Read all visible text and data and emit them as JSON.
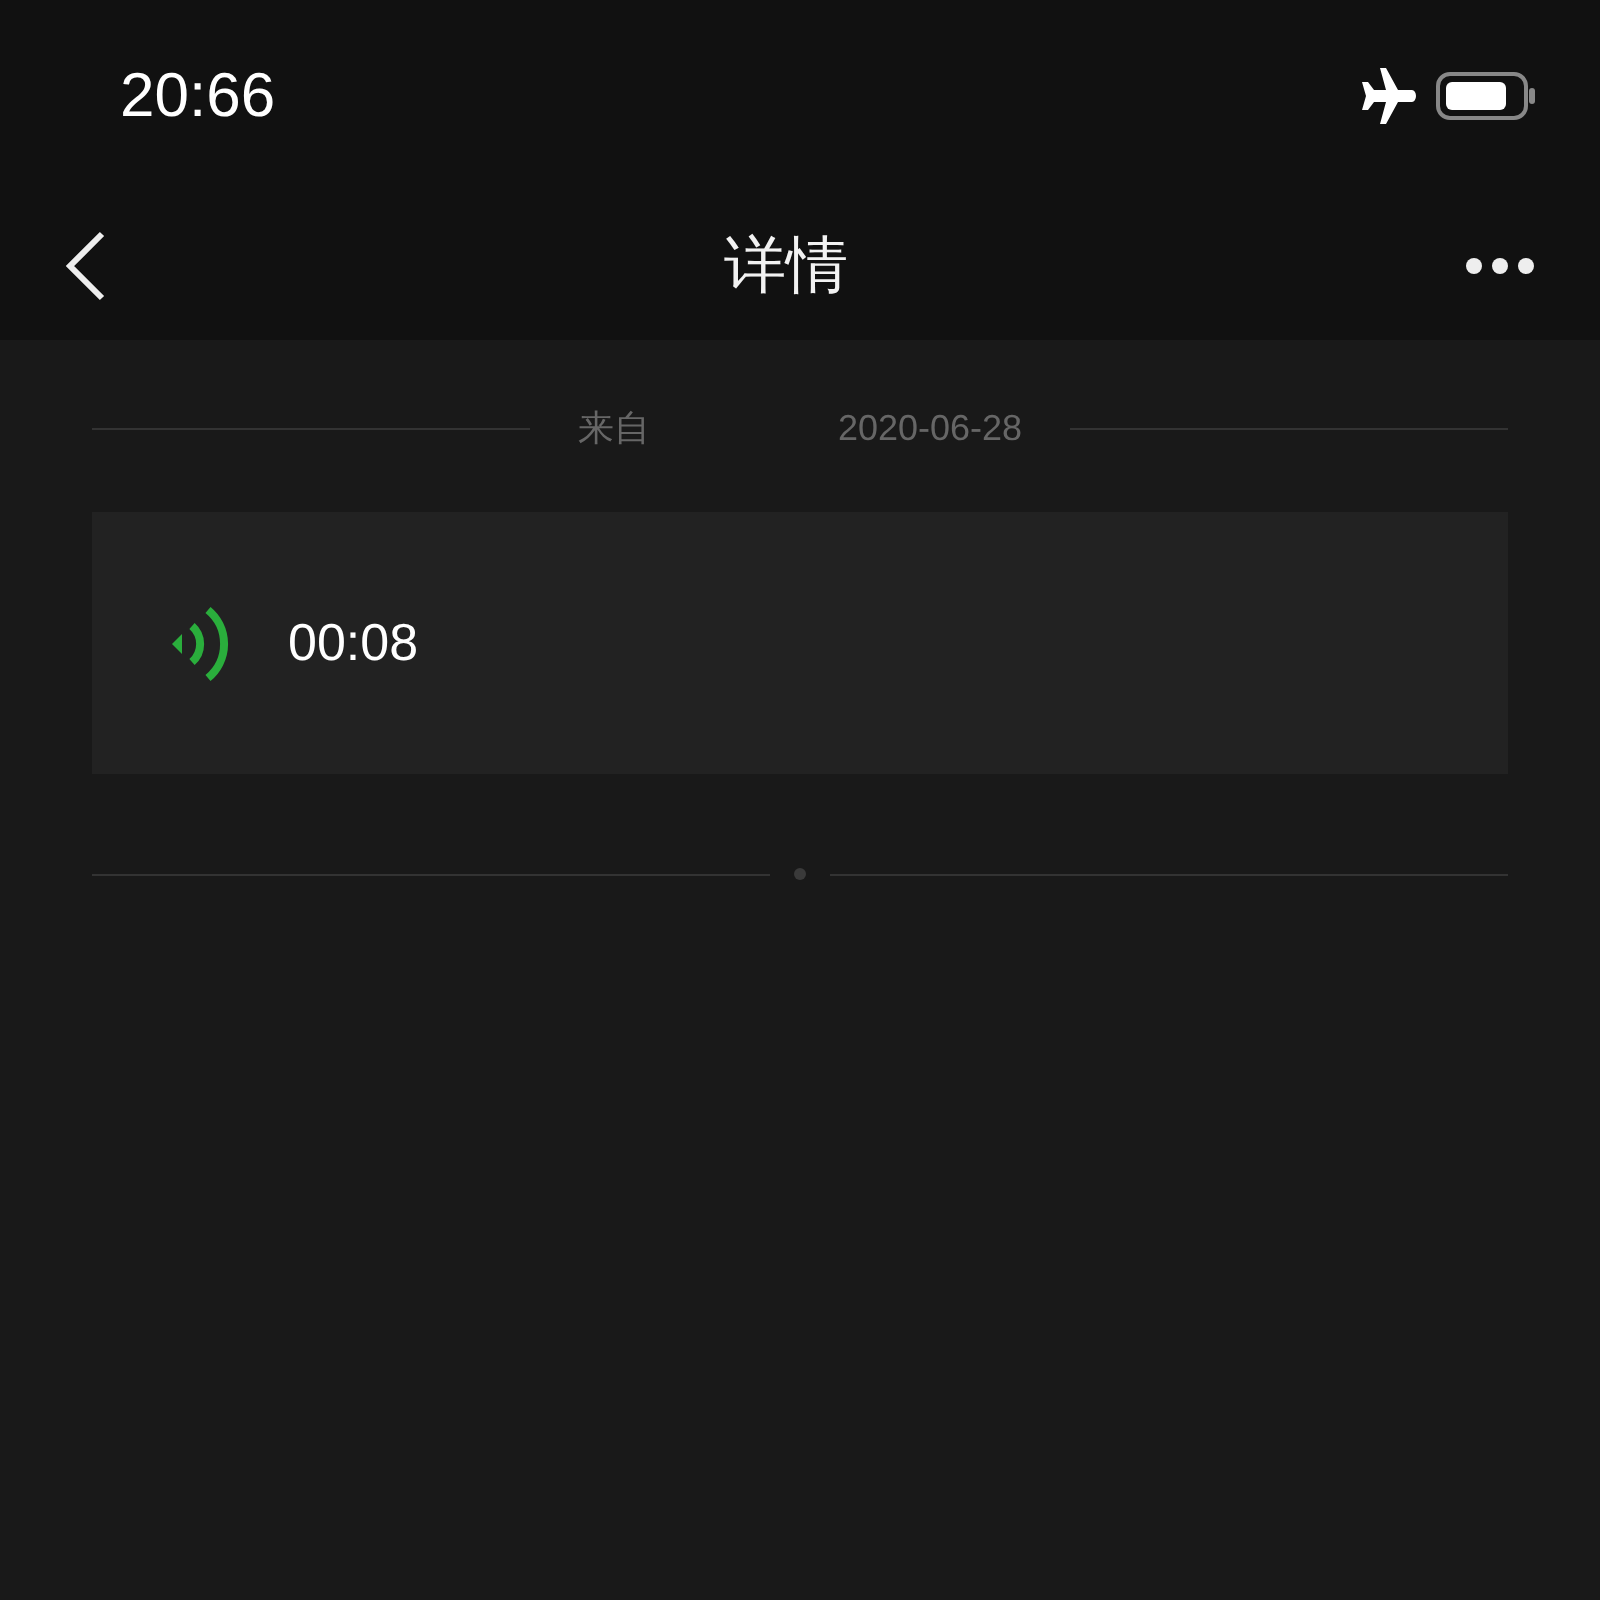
{
  "status_bar": {
    "time": "20:66",
    "airplane_mode": true
  },
  "nav": {
    "title": "详情"
  },
  "meta": {
    "source_label": "来自",
    "date": "2020-06-28"
  },
  "voice_message": {
    "duration": "00:08"
  }
}
